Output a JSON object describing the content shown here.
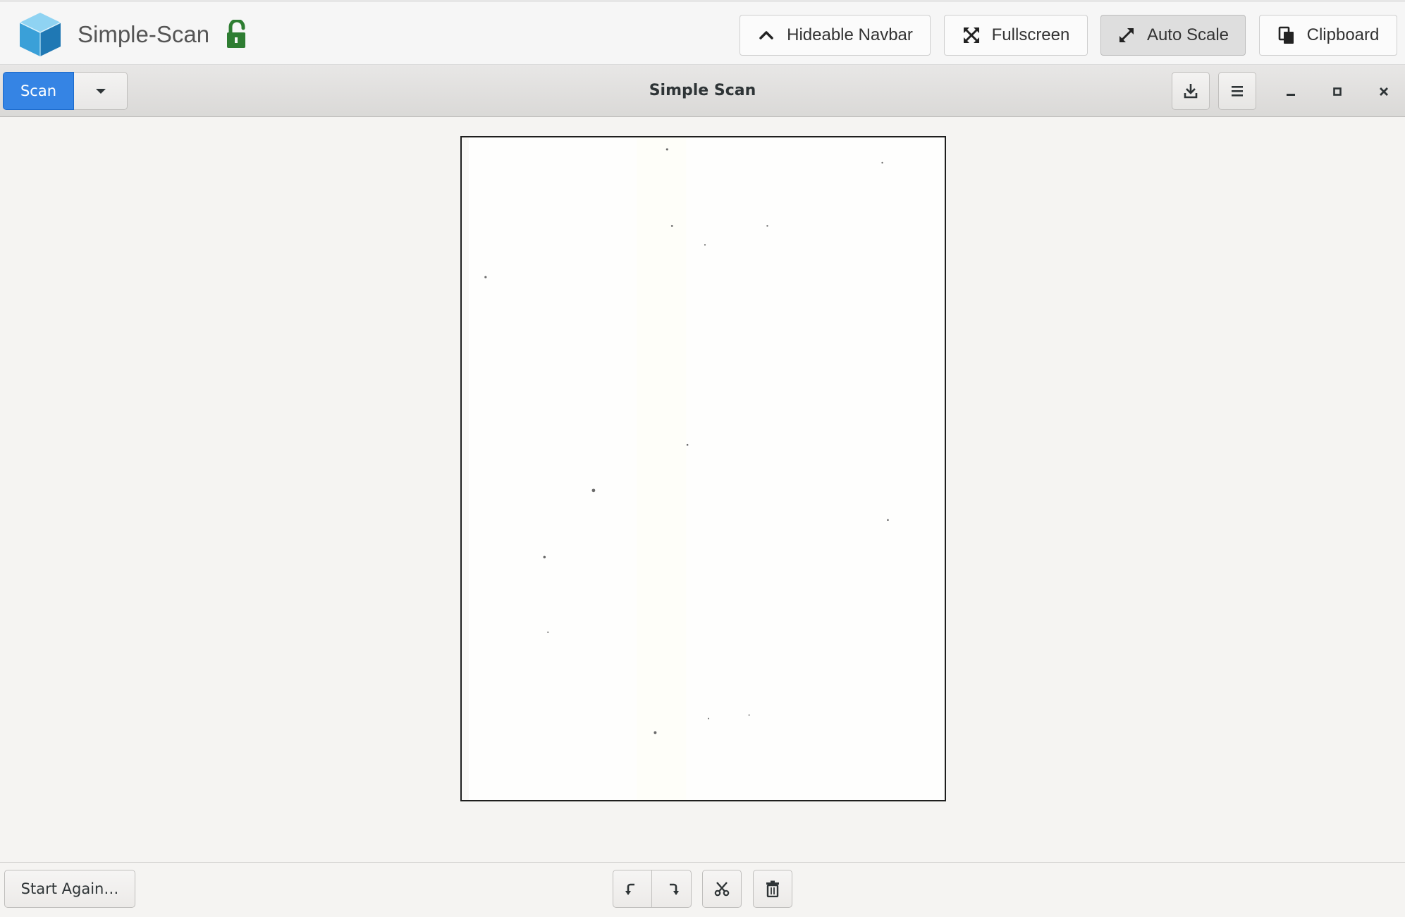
{
  "navbar": {
    "app_title": "Simple-Scan",
    "logo_icon": "cube-logo-icon",
    "lock_icon": "unlocked-padlock-icon",
    "lock_color": "#2e7d32",
    "buttons": {
      "hideable_navbar": {
        "label": "Hideable Navbar",
        "icon": "chevron-up-icon"
      },
      "fullscreen": {
        "label": "Fullscreen",
        "icon": "expand-arrows-icon"
      },
      "auto_scale": {
        "label": "Auto Scale",
        "icon": "diagonal-resize-icon",
        "active": true
      },
      "clipboard": {
        "label": "Clipboard",
        "icon": "clipboard-copy-icon"
      }
    }
  },
  "headerbar": {
    "scan_label": "Scan",
    "scan_color": "#3584e4",
    "title": "Simple Scan",
    "save_icon": "download-save-icon",
    "menu_icon": "hamburger-menu-icon",
    "window_controls": [
      "minimize-icon",
      "maximize-icon",
      "close-icon"
    ]
  },
  "document": {
    "page_count_shown": 1,
    "page_background": "#fefefd"
  },
  "actionbar": {
    "start_again_label": "Start Again…",
    "tools": [
      "rotate-left-icon",
      "rotate-right-icon",
      "crop-scissors-icon",
      "delete-trash-icon"
    ]
  }
}
